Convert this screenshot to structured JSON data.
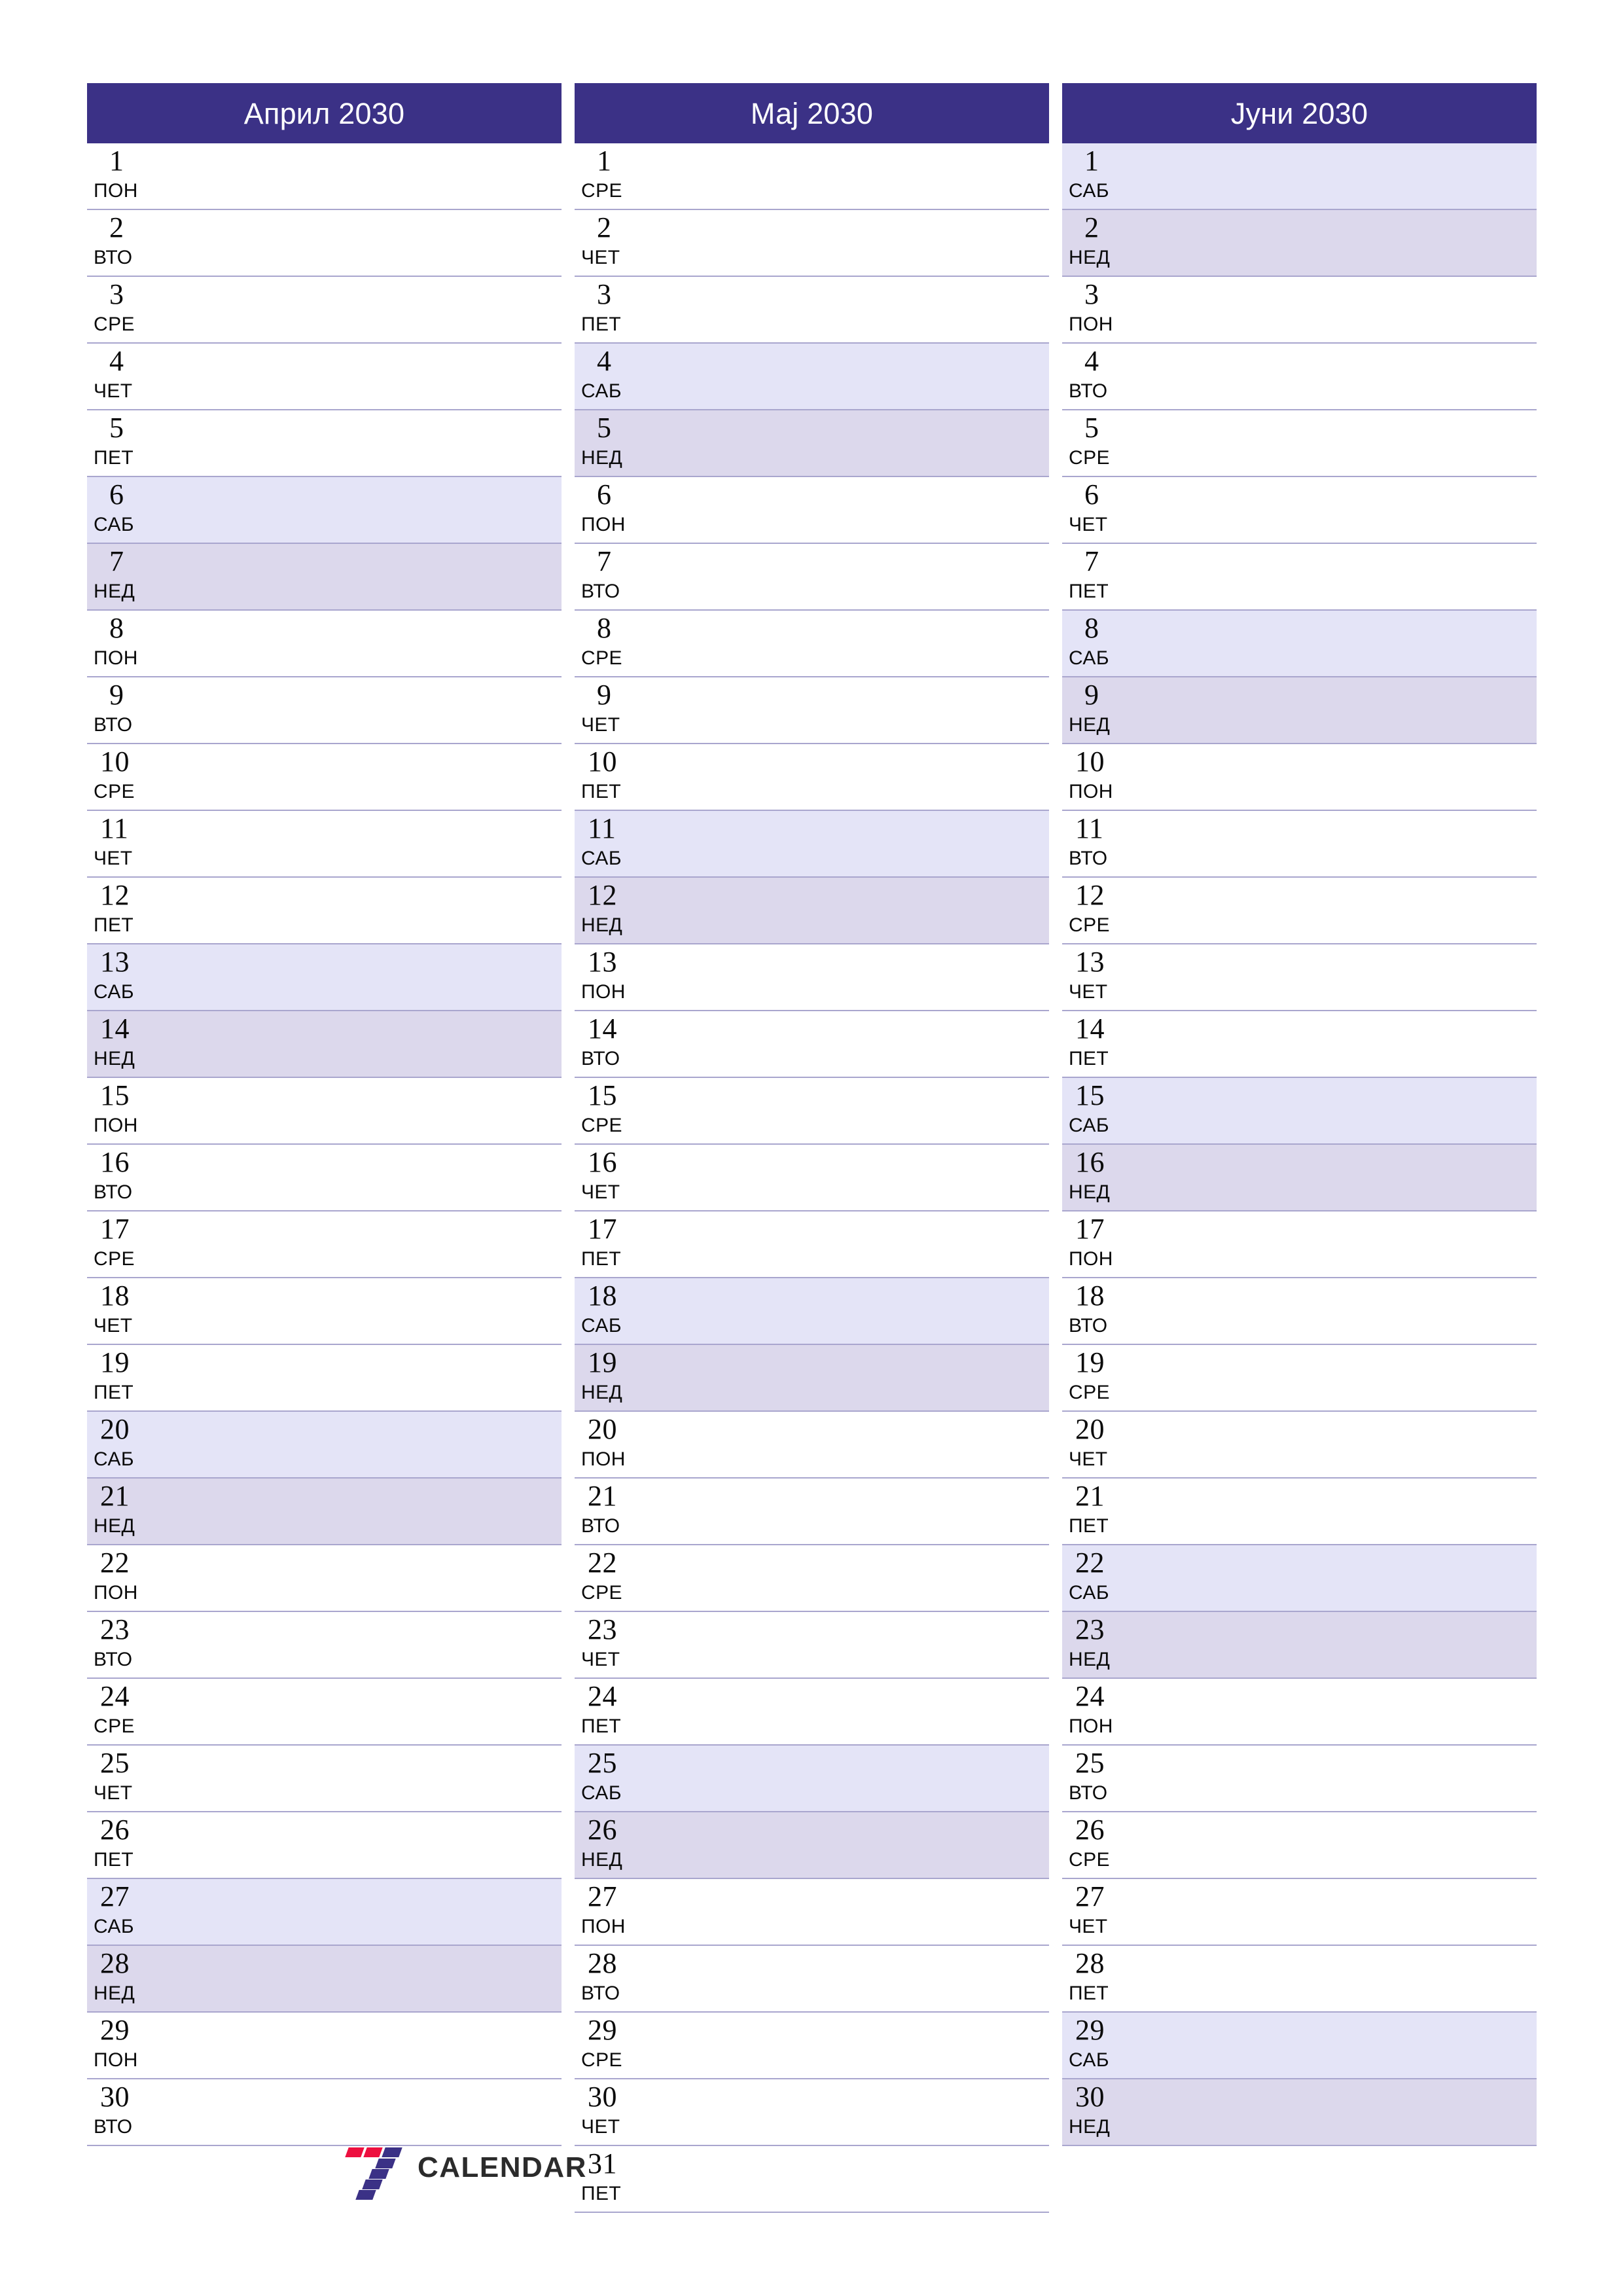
{
  "colors": {
    "header_bg": "#3b3186",
    "header_text": "#ffffff",
    "saturday_bg": "#e4e4f7",
    "sunday_bg": "#dcd8ec",
    "row_border": "#a9a6ce",
    "page_bg": "#ffffff",
    "logo_red": "#ed0f3f",
    "logo_purple": "#3b3186",
    "logo_text": "#2b2b2b"
  },
  "brand": {
    "mark": "seven-logo-icon",
    "name": "CALENDAR"
  },
  "months": [
    {
      "title": "Април 2030",
      "days": [
        {
          "num": "1",
          "weekday": "ПОН",
          "type": "weekday"
        },
        {
          "num": "2",
          "weekday": "ВТО",
          "type": "weekday"
        },
        {
          "num": "3",
          "weekday": "СРЕ",
          "type": "weekday"
        },
        {
          "num": "4",
          "weekday": "ЧЕТ",
          "type": "weekday"
        },
        {
          "num": "5",
          "weekday": "ПЕТ",
          "type": "weekday"
        },
        {
          "num": "6",
          "weekday": "САБ",
          "type": "sat"
        },
        {
          "num": "7",
          "weekday": "НЕД",
          "type": "sun"
        },
        {
          "num": "8",
          "weekday": "ПОН",
          "type": "weekday"
        },
        {
          "num": "9",
          "weekday": "ВТО",
          "type": "weekday"
        },
        {
          "num": "10",
          "weekday": "СРЕ",
          "type": "weekday"
        },
        {
          "num": "11",
          "weekday": "ЧЕТ",
          "type": "weekday"
        },
        {
          "num": "12",
          "weekday": "ПЕТ",
          "type": "weekday"
        },
        {
          "num": "13",
          "weekday": "САБ",
          "type": "sat"
        },
        {
          "num": "14",
          "weekday": "НЕД",
          "type": "sun"
        },
        {
          "num": "15",
          "weekday": "ПОН",
          "type": "weekday"
        },
        {
          "num": "16",
          "weekday": "ВТО",
          "type": "weekday"
        },
        {
          "num": "17",
          "weekday": "СРЕ",
          "type": "weekday"
        },
        {
          "num": "18",
          "weekday": "ЧЕТ",
          "type": "weekday"
        },
        {
          "num": "19",
          "weekday": "ПЕТ",
          "type": "weekday"
        },
        {
          "num": "20",
          "weekday": "САБ",
          "type": "sat"
        },
        {
          "num": "21",
          "weekday": "НЕД",
          "type": "sun"
        },
        {
          "num": "22",
          "weekday": "ПОН",
          "type": "weekday"
        },
        {
          "num": "23",
          "weekday": "ВТО",
          "type": "weekday"
        },
        {
          "num": "24",
          "weekday": "СРЕ",
          "type": "weekday"
        },
        {
          "num": "25",
          "weekday": "ЧЕТ",
          "type": "weekday"
        },
        {
          "num": "26",
          "weekday": "ПЕТ",
          "type": "weekday"
        },
        {
          "num": "27",
          "weekday": "САБ",
          "type": "sat"
        },
        {
          "num": "28",
          "weekday": "НЕД",
          "type": "sun"
        },
        {
          "num": "29",
          "weekday": "ПОН",
          "type": "weekday"
        },
        {
          "num": "30",
          "weekday": "ВТО",
          "type": "weekday"
        }
      ]
    },
    {
      "title": "Мај 2030",
      "days": [
        {
          "num": "1",
          "weekday": "СРЕ",
          "type": "weekday"
        },
        {
          "num": "2",
          "weekday": "ЧЕТ",
          "type": "weekday"
        },
        {
          "num": "3",
          "weekday": "ПЕТ",
          "type": "weekday"
        },
        {
          "num": "4",
          "weekday": "САБ",
          "type": "sat"
        },
        {
          "num": "5",
          "weekday": "НЕД",
          "type": "sun"
        },
        {
          "num": "6",
          "weekday": "ПОН",
          "type": "weekday"
        },
        {
          "num": "7",
          "weekday": "ВТО",
          "type": "weekday"
        },
        {
          "num": "8",
          "weekday": "СРЕ",
          "type": "weekday"
        },
        {
          "num": "9",
          "weekday": "ЧЕТ",
          "type": "weekday"
        },
        {
          "num": "10",
          "weekday": "ПЕТ",
          "type": "weekday"
        },
        {
          "num": "11",
          "weekday": "САБ",
          "type": "sat"
        },
        {
          "num": "12",
          "weekday": "НЕД",
          "type": "sun"
        },
        {
          "num": "13",
          "weekday": "ПОН",
          "type": "weekday"
        },
        {
          "num": "14",
          "weekday": "ВТО",
          "type": "weekday"
        },
        {
          "num": "15",
          "weekday": "СРЕ",
          "type": "weekday"
        },
        {
          "num": "16",
          "weekday": "ЧЕТ",
          "type": "weekday"
        },
        {
          "num": "17",
          "weekday": "ПЕТ",
          "type": "weekday"
        },
        {
          "num": "18",
          "weekday": "САБ",
          "type": "sat"
        },
        {
          "num": "19",
          "weekday": "НЕД",
          "type": "sun"
        },
        {
          "num": "20",
          "weekday": "ПОН",
          "type": "weekday"
        },
        {
          "num": "21",
          "weekday": "ВТО",
          "type": "weekday"
        },
        {
          "num": "22",
          "weekday": "СРЕ",
          "type": "weekday"
        },
        {
          "num": "23",
          "weekday": "ЧЕТ",
          "type": "weekday"
        },
        {
          "num": "24",
          "weekday": "ПЕТ",
          "type": "weekday"
        },
        {
          "num": "25",
          "weekday": "САБ",
          "type": "sat"
        },
        {
          "num": "26",
          "weekday": "НЕД",
          "type": "sun"
        },
        {
          "num": "27",
          "weekday": "ПОН",
          "type": "weekday"
        },
        {
          "num": "28",
          "weekday": "ВТО",
          "type": "weekday"
        },
        {
          "num": "29",
          "weekday": "СРЕ",
          "type": "weekday"
        },
        {
          "num": "30",
          "weekday": "ЧЕТ",
          "type": "weekday"
        },
        {
          "num": "31",
          "weekday": "ПЕТ",
          "type": "weekday"
        }
      ]
    },
    {
      "title": "Јуни 2030",
      "days": [
        {
          "num": "1",
          "weekday": "САБ",
          "type": "sat"
        },
        {
          "num": "2",
          "weekday": "НЕД",
          "type": "sun"
        },
        {
          "num": "3",
          "weekday": "ПОН",
          "type": "weekday"
        },
        {
          "num": "4",
          "weekday": "ВТО",
          "type": "weekday"
        },
        {
          "num": "5",
          "weekday": "СРЕ",
          "type": "weekday"
        },
        {
          "num": "6",
          "weekday": "ЧЕТ",
          "type": "weekday"
        },
        {
          "num": "7",
          "weekday": "ПЕТ",
          "type": "weekday"
        },
        {
          "num": "8",
          "weekday": "САБ",
          "type": "sat"
        },
        {
          "num": "9",
          "weekday": "НЕД",
          "type": "sun"
        },
        {
          "num": "10",
          "weekday": "ПОН",
          "type": "weekday"
        },
        {
          "num": "11",
          "weekday": "ВТО",
          "type": "weekday"
        },
        {
          "num": "12",
          "weekday": "СРЕ",
          "type": "weekday"
        },
        {
          "num": "13",
          "weekday": "ЧЕТ",
          "type": "weekday"
        },
        {
          "num": "14",
          "weekday": "ПЕТ",
          "type": "weekday"
        },
        {
          "num": "15",
          "weekday": "САБ",
          "type": "sat"
        },
        {
          "num": "16",
          "weekday": "НЕД",
          "type": "sun"
        },
        {
          "num": "17",
          "weekday": "ПОН",
          "type": "weekday"
        },
        {
          "num": "18",
          "weekday": "ВТО",
          "type": "weekday"
        },
        {
          "num": "19",
          "weekday": "СРЕ",
          "type": "weekday"
        },
        {
          "num": "20",
          "weekday": "ЧЕТ",
          "type": "weekday"
        },
        {
          "num": "21",
          "weekday": "ПЕТ",
          "type": "weekday"
        },
        {
          "num": "22",
          "weekday": "САБ",
          "type": "sat"
        },
        {
          "num": "23",
          "weekday": "НЕД",
          "type": "sun"
        },
        {
          "num": "24",
          "weekday": "ПОН",
          "type": "weekday"
        },
        {
          "num": "25",
          "weekday": "ВТО",
          "type": "weekday"
        },
        {
          "num": "26",
          "weekday": "СРЕ",
          "type": "weekday"
        },
        {
          "num": "27",
          "weekday": "ЧЕТ",
          "type": "weekday"
        },
        {
          "num": "28",
          "weekday": "ПЕТ",
          "type": "weekday"
        },
        {
          "num": "29",
          "weekday": "САБ",
          "type": "sat"
        },
        {
          "num": "30",
          "weekday": "НЕД",
          "type": "sun"
        }
      ]
    }
  ]
}
